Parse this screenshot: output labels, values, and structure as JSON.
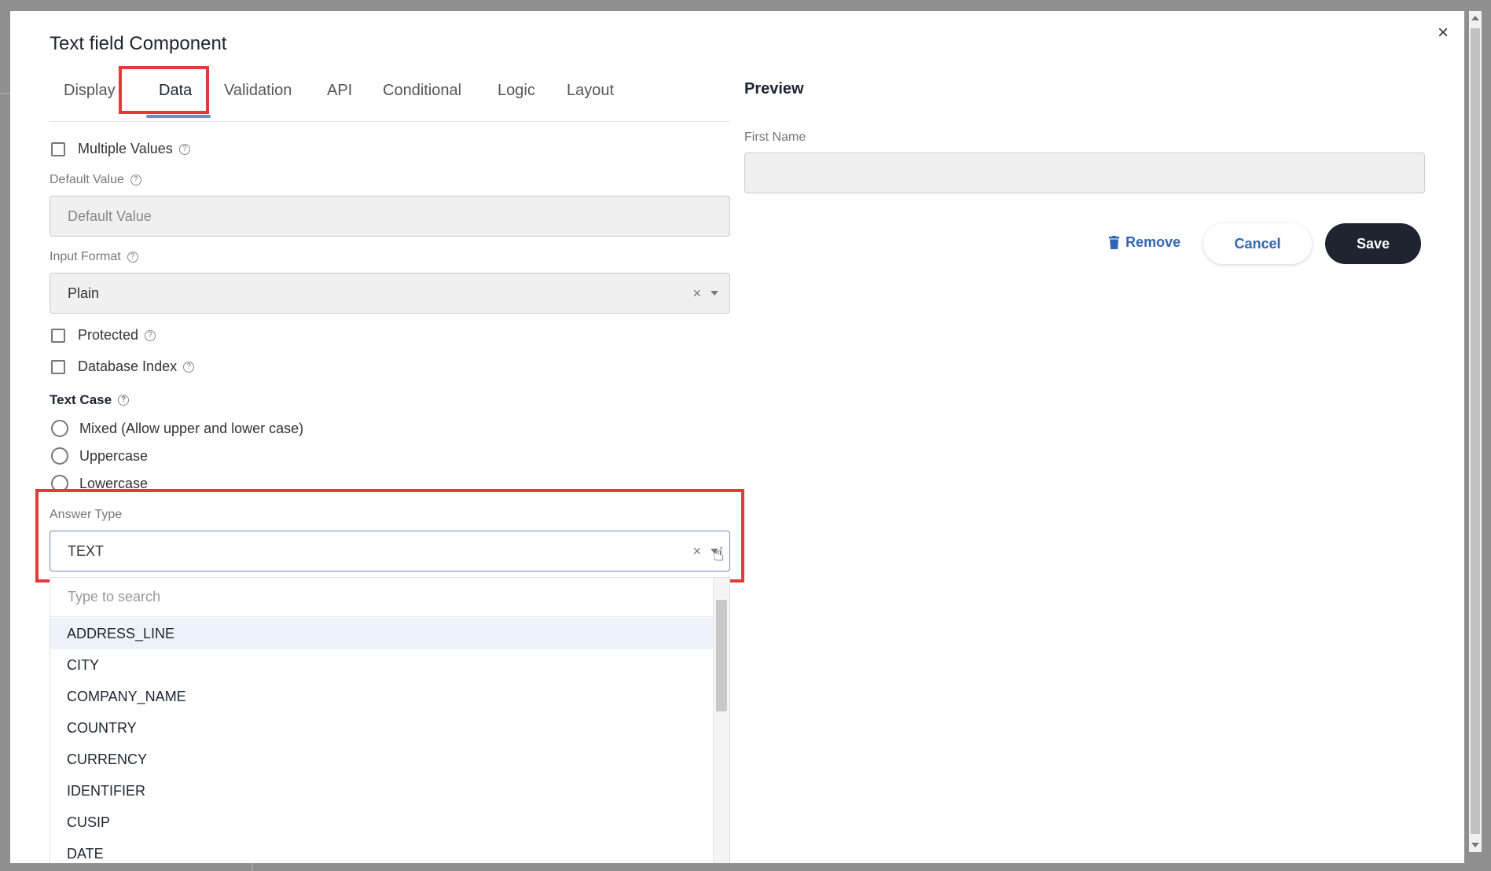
{
  "modal": {
    "title": "Text field Component",
    "close": "×"
  },
  "tabs": [
    {
      "label": "Display",
      "active": false
    },
    {
      "label": "Data",
      "active": true
    },
    {
      "label": "Validation",
      "active": false
    },
    {
      "label": "API",
      "active": false
    },
    {
      "label": "Conditional",
      "active": false
    },
    {
      "label": "Logic",
      "active": false
    },
    {
      "label": "Layout",
      "active": false
    }
  ],
  "form": {
    "multiple_values_label": "Multiple Values",
    "default_value_label": "Default Value",
    "default_value_placeholder": "Default Value",
    "input_format_label": "Input Format",
    "input_format_value": "Plain",
    "protected_label": "Protected",
    "database_index_label": "Database Index",
    "text_case_label": "Text Case",
    "text_case_options": [
      "Mixed (Allow upper and lower case)",
      "Uppercase",
      "Lowercase"
    ],
    "answer_type_label": "Answer Type",
    "answer_type_value": "TEXT"
  },
  "dropdown": {
    "search_placeholder": "Type to search",
    "items": [
      "ADDRESS_LINE",
      "CITY",
      "COMPANY_NAME",
      "COUNTRY",
      "CURRENCY",
      "IDENTIFIER",
      "CUSIP",
      "DATE"
    ],
    "highlighted_index": 0
  },
  "preview": {
    "title": "Preview",
    "field_label": "First Name"
  },
  "actions": {
    "remove_label": "Remove",
    "cancel_label": "Cancel",
    "save_label": "Save"
  },
  "icons": {
    "help": "?",
    "clear": "×",
    "trash": "trash-icon",
    "hand_cursor": "☝"
  },
  "colors": {
    "annotation": "#e23a3a",
    "accent": "#2f66b3",
    "save_bg": "#1e2430"
  }
}
